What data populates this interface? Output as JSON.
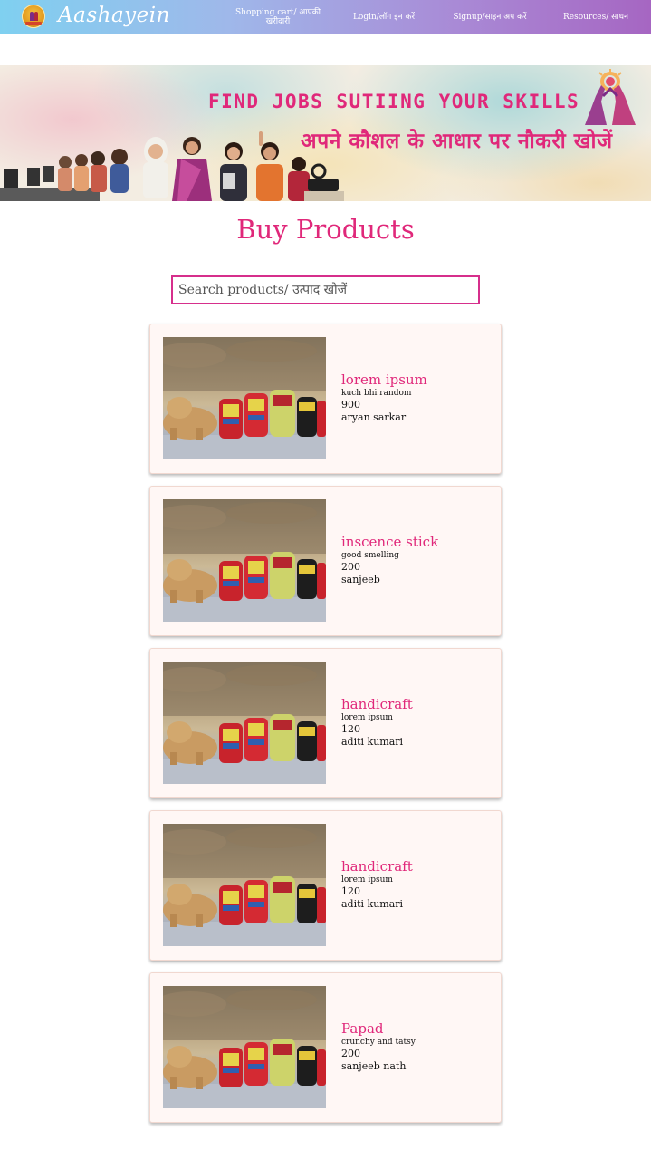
{
  "navbar": {
    "brand": "Aashayein",
    "links": [
      {
        "label": "Shopping cart/ आपकी खरीदारी"
      },
      {
        "label": "Login/लॉग इन करें"
      },
      {
        "label": "Signup/साइन अप करें"
      },
      {
        "label": "Resources/ साधन"
      }
    ]
  },
  "banner": {
    "headline_en": "FIND JOBS SUTIING YOUR SKILLS",
    "headline_hi": "अपने कौशल के आधार पर नौकरी खोजें"
  },
  "page": {
    "title": "Buy Products"
  },
  "search": {
    "placeholder": "Search products/ उत्पाद खोजें",
    "value": ""
  },
  "products": [
    {
      "name": "lorem ipsum",
      "description": "kuch bhi random",
      "price": "900",
      "seller": "aryan sarkar",
      "image": "wooden-elephant-figurines-photo"
    },
    {
      "name": "inscence stick",
      "description": "good smelling",
      "price": "200",
      "seller": "sanjeeb",
      "image": "wooden-elephant-figurines-photo"
    },
    {
      "name": "handicraft",
      "description": "lorem ipsum",
      "price": "120",
      "seller": "aditi kumari",
      "image": "wooden-elephant-figurines-photo"
    },
    {
      "name": "handicraft",
      "description": "lorem ipsum",
      "price": "120",
      "seller": "aditi kumari",
      "image": "wooden-elephant-figurines-photo"
    },
    {
      "name": "Papad",
      "description": "crunchy and tatsy",
      "price": "200",
      "seller": "sanjeeb nath",
      "image": "wooden-elephant-figurines-photo"
    }
  ],
  "colors": {
    "accent": "#e0287a",
    "search_border": "#d62f8c",
    "card_bg": "#fff7f5"
  }
}
